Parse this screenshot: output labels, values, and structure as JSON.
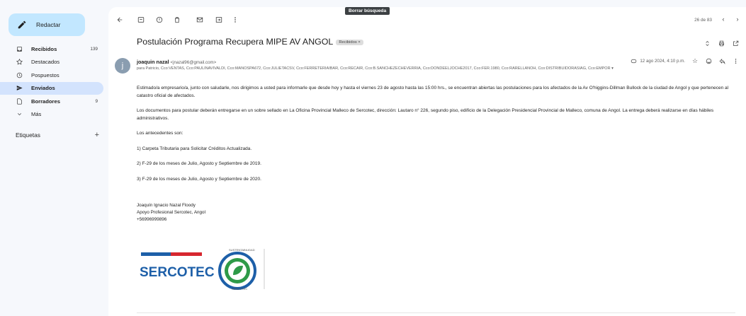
{
  "sidebar": {
    "compose_label": "Redactar",
    "items": [
      {
        "label": "Recibidos",
        "count": "139",
        "icon": "inbox-icon",
        "bold": true
      },
      {
        "label": "Destacados",
        "count": "",
        "icon": "star-icon",
        "bold": false
      },
      {
        "label": "Pospuestos",
        "count": "",
        "icon": "clock-icon",
        "bold": false
      },
      {
        "label": "Enviados",
        "count": "",
        "icon": "send-icon",
        "bold": true
      },
      {
        "label": "Borradores",
        "count": "9",
        "icon": "draft-icon",
        "bold": true
      },
      {
        "label": "Más",
        "count": "",
        "icon": "chevron-down-icon",
        "bold": false
      }
    ],
    "labels_heading": "Etiquetas",
    "labels_add": "+"
  },
  "toolbar": {
    "tooltip": "Borrar búsqueda",
    "pager": "26 de 83"
  },
  "email": {
    "subject": "Postulación Programa Recupera MIPE AV ANGOL",
    "badge": "Recibidos ×",
    "sender_name": "joaquin nazal",
    "sender_email": "<jnazal96@gmail.com>",
    "recipients": "para Patricio, Cco:VENTAS, Cco:PAULINAVIVALDI, Cco:MANOSPA672, Cco:JULIETACSV, Cco:FERRETERIAIBAR, Cco:RECAIR, Cco:B.SANCHEZECHEVERRIA, Cco:DONDEELJOCHE2017, Cco:FER.1980, Cco:RARELLANOH, Cco:DISTRIBUIDORASIAG, Cco:EMPOR ▾",
    "date": "12 ago 2024, 4:10 p.m.",
    "avatar_letter": "j",
    "body": [
      "Estimado/a empresario/a, junto con saludarle, nos dirigimos a usted para informarle que desde hoy y hasta el viernes 23 de agosto hasta las 15:00 hrs., se encuentran abiertas las postulaciones para los afectados de la Av O'higgins-Dillman Bullock de la ciudad de Angol y que pertenecen al catastro oficial de afectados.",
      "Los  documentos para postular deberán entregarse en un sobre sellado en La Oficina Provincial Malleco de Sercotec, dirección: Lautaro n° 226, segundo piso, edificio de la Delegación Presidencial Provincial de Malleco, comuna de Angol. La entrega deberá realizarse en días hábiles administrativos.",
      "Los antecedentes son:",
      "1) Carpeta Tributaria para Solicitar Créditos Actualizada.",
      "2) F-29 de los meses de Julio, Agosto y Septiembre de 2019.",
      "3) F-29 de los meses de Julio, Agosto y Septiembre de 2020."
    ],
    "signature": [
      "Joaquín Ignacio Nazal Floody",
      "Apoyo Profesional Sercotec, Angol",
      "+56996999896"
    ],
    "logo_text": "SERCOTEC",
    "seal_text_top": "SUSTENTABILIDAD",
    "seal_text_bottom": "SERCOTEC"
  }
}
